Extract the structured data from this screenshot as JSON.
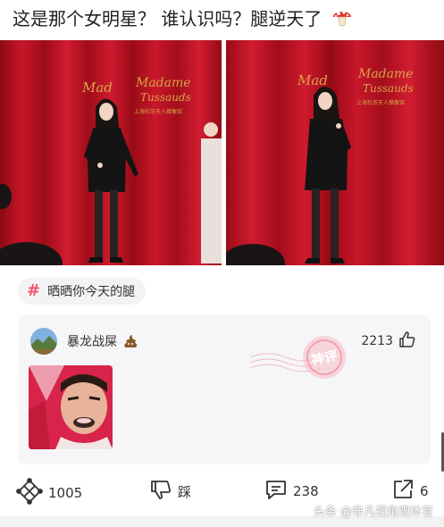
{
  "post": {
    "title": "这是那个女明星？ 谁认识吗？腿逆天了",
    "title_icon": "mushroom-emoji-icon",
    "photos": [
      {
        "sign_main": "Madame",
        "sign_sub": "Tussauds",
        "sign_cn": "上海杜莎夫人蜡像馆",
        "sign_left": "Mad"
      },
      {
        "sign_main": "Madame",
        "sign_sub": "Tussauds",
        "sign_cn": "上海杜莎夫人蜡像馆",
        "sign_left": "Mad"
      }
    ]
  },
  "topic": {
    "icon": "hash-icon",
    "label": "晒晒你今天的腿",
    "accent": "#f3526b"
  },
  "comment": {
    "username": "暴龙战屎",
    "user_badge": "poop-emoji-icon",
    "likes": "2213",
    "stamp_text": "神评"
  },
  "actions": {
    "share_count": "1005",
    "dislike_label": "踩",
    "comment_count": "238",
    "forward_count": "6"
  },
  "watermark": "头条 @非凡视角观体育"
}
